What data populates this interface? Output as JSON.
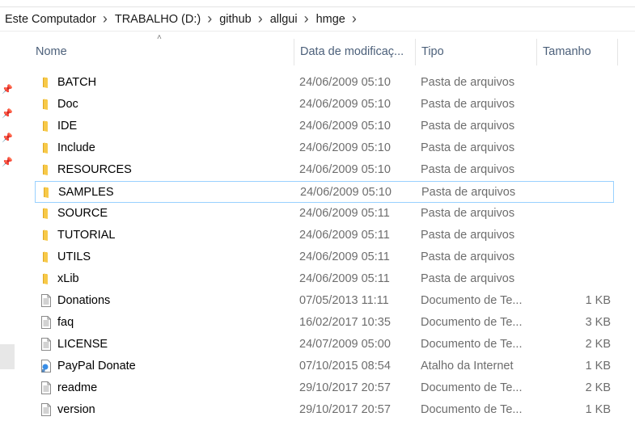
{
  "breadcrumb": [
    "Este Computador",
    "TRABALHO (D:)",
    "github",
    "allgui",
    "hmge"
  ],
  "columns": {
    "name": "Nome",
    "date": "Data de modificaç...",
    "type": "Tipo",
    "size": "Tamanho"
  },
  "files": [
    {
      "name": "BATCH",
      "date": "24/06/2009 05:10",
      "type": "Pasta de arquivos",
      "size": "",
      "icon": "folder-icon"
    },
    {
      "name": "Doc",
      "date": "24/06/2009 05:10",
      "type": "Pasta de arquivos",
      "size": "",
      "icon": "folder-icon"
    },
    {
      "name": "IDE",
      "date": "24/06/2009 05:10",
      "type": "Pasta de arquivos",
      "size": "",
      "icon": "folder-icon"
    },
    {
      "name": "Include",
      "date": "24/06/2009 05:10",
      "type": "Pasta de arquivos",
      "size": "",
      "icon": "folder-icon"
    },
    {
      "name": "RESOURCES",
      "date": "24/06/2009 05:10",
      "type": "Pasta de arquivos",
      "size": "",
      "icon": "folder-icon"
    },
    {
      "name": "SAMPLES",
      "date": "24/06/2009 05:10",
      "type": "Pasta de arquivos",
      "size": "",
      "icon": "folder-icon",
      "selected": true
    },
    {
      "name": "SOURCE",
      "date": "24/06/2009 05:11",
      "type": "Pasta de arquivos",
      "size": "",
      "icon": "folder-icon"
    },
    {
      "name": "TUTORIAL",
      "date": "24/06/2009 05:11",
      "type": "Pasta de arquivos",
      "size": "",
      "icon": "folder-icon"
    },
    {
      "name": "UTILS",
      "date": "24/06/2009 05:11",
      "type": "Pasta de arquivos",
      "size": "",
      "icon": "folder-icon"
    },
    {
      "name": "xLib",
      "date": "24/06/2009 05:11",
      "type": "Pasta de arquivos",
      "size": "",
      "icon": "folder-icon"
    },
    {
      "name": "Donations",
      "date": "07/05/2013 11:11",
      "type": "Documento de Te...",
      "size": "1 KB",
      "icon": "text-document-icon"
    },
    {
      "name": "faq",
      "date": "16/02/2017 10:35",
      "type": "Documento de Te...",
      "size": "3 KB",
      "icon": "text-document-icon"
    },
    {
      "name": "LICENSE",
      "date": "24/07/2009 05:00",
      "type": "Documento de Te...",
      "size": "2 KB",
      "icon": "text-document-icon"
    },
    {
      "name": "PayPal Donate",
      "date": "07/10/2015 08:54",
      "type": "Atalho da Internet",
      "size": "1 KB",
      "icon": "internet-shortcut-icon"
    },
    {
      "name": "readme",
      "date": "29/10/2017 20:57",
      "type": "Documento de Te...",
      "size": "2 KB",
      "icon": "text-document-icon"
    },
    {
      "name": "version",
      "date": "29/10/2017 20:57",
      "type": "Documento de Te...",
      "size": "1 KB",
      "icon": "text-document-icon"
    }
  ],
  "colors": {
    "folder": "#f7c948",
    "folder_dark": "#e0a823",
    "header_text": "#4c607a",
    "selection_border": "#99d1ff",
    "secondary_text": "#6d6d6d"
  }
}
